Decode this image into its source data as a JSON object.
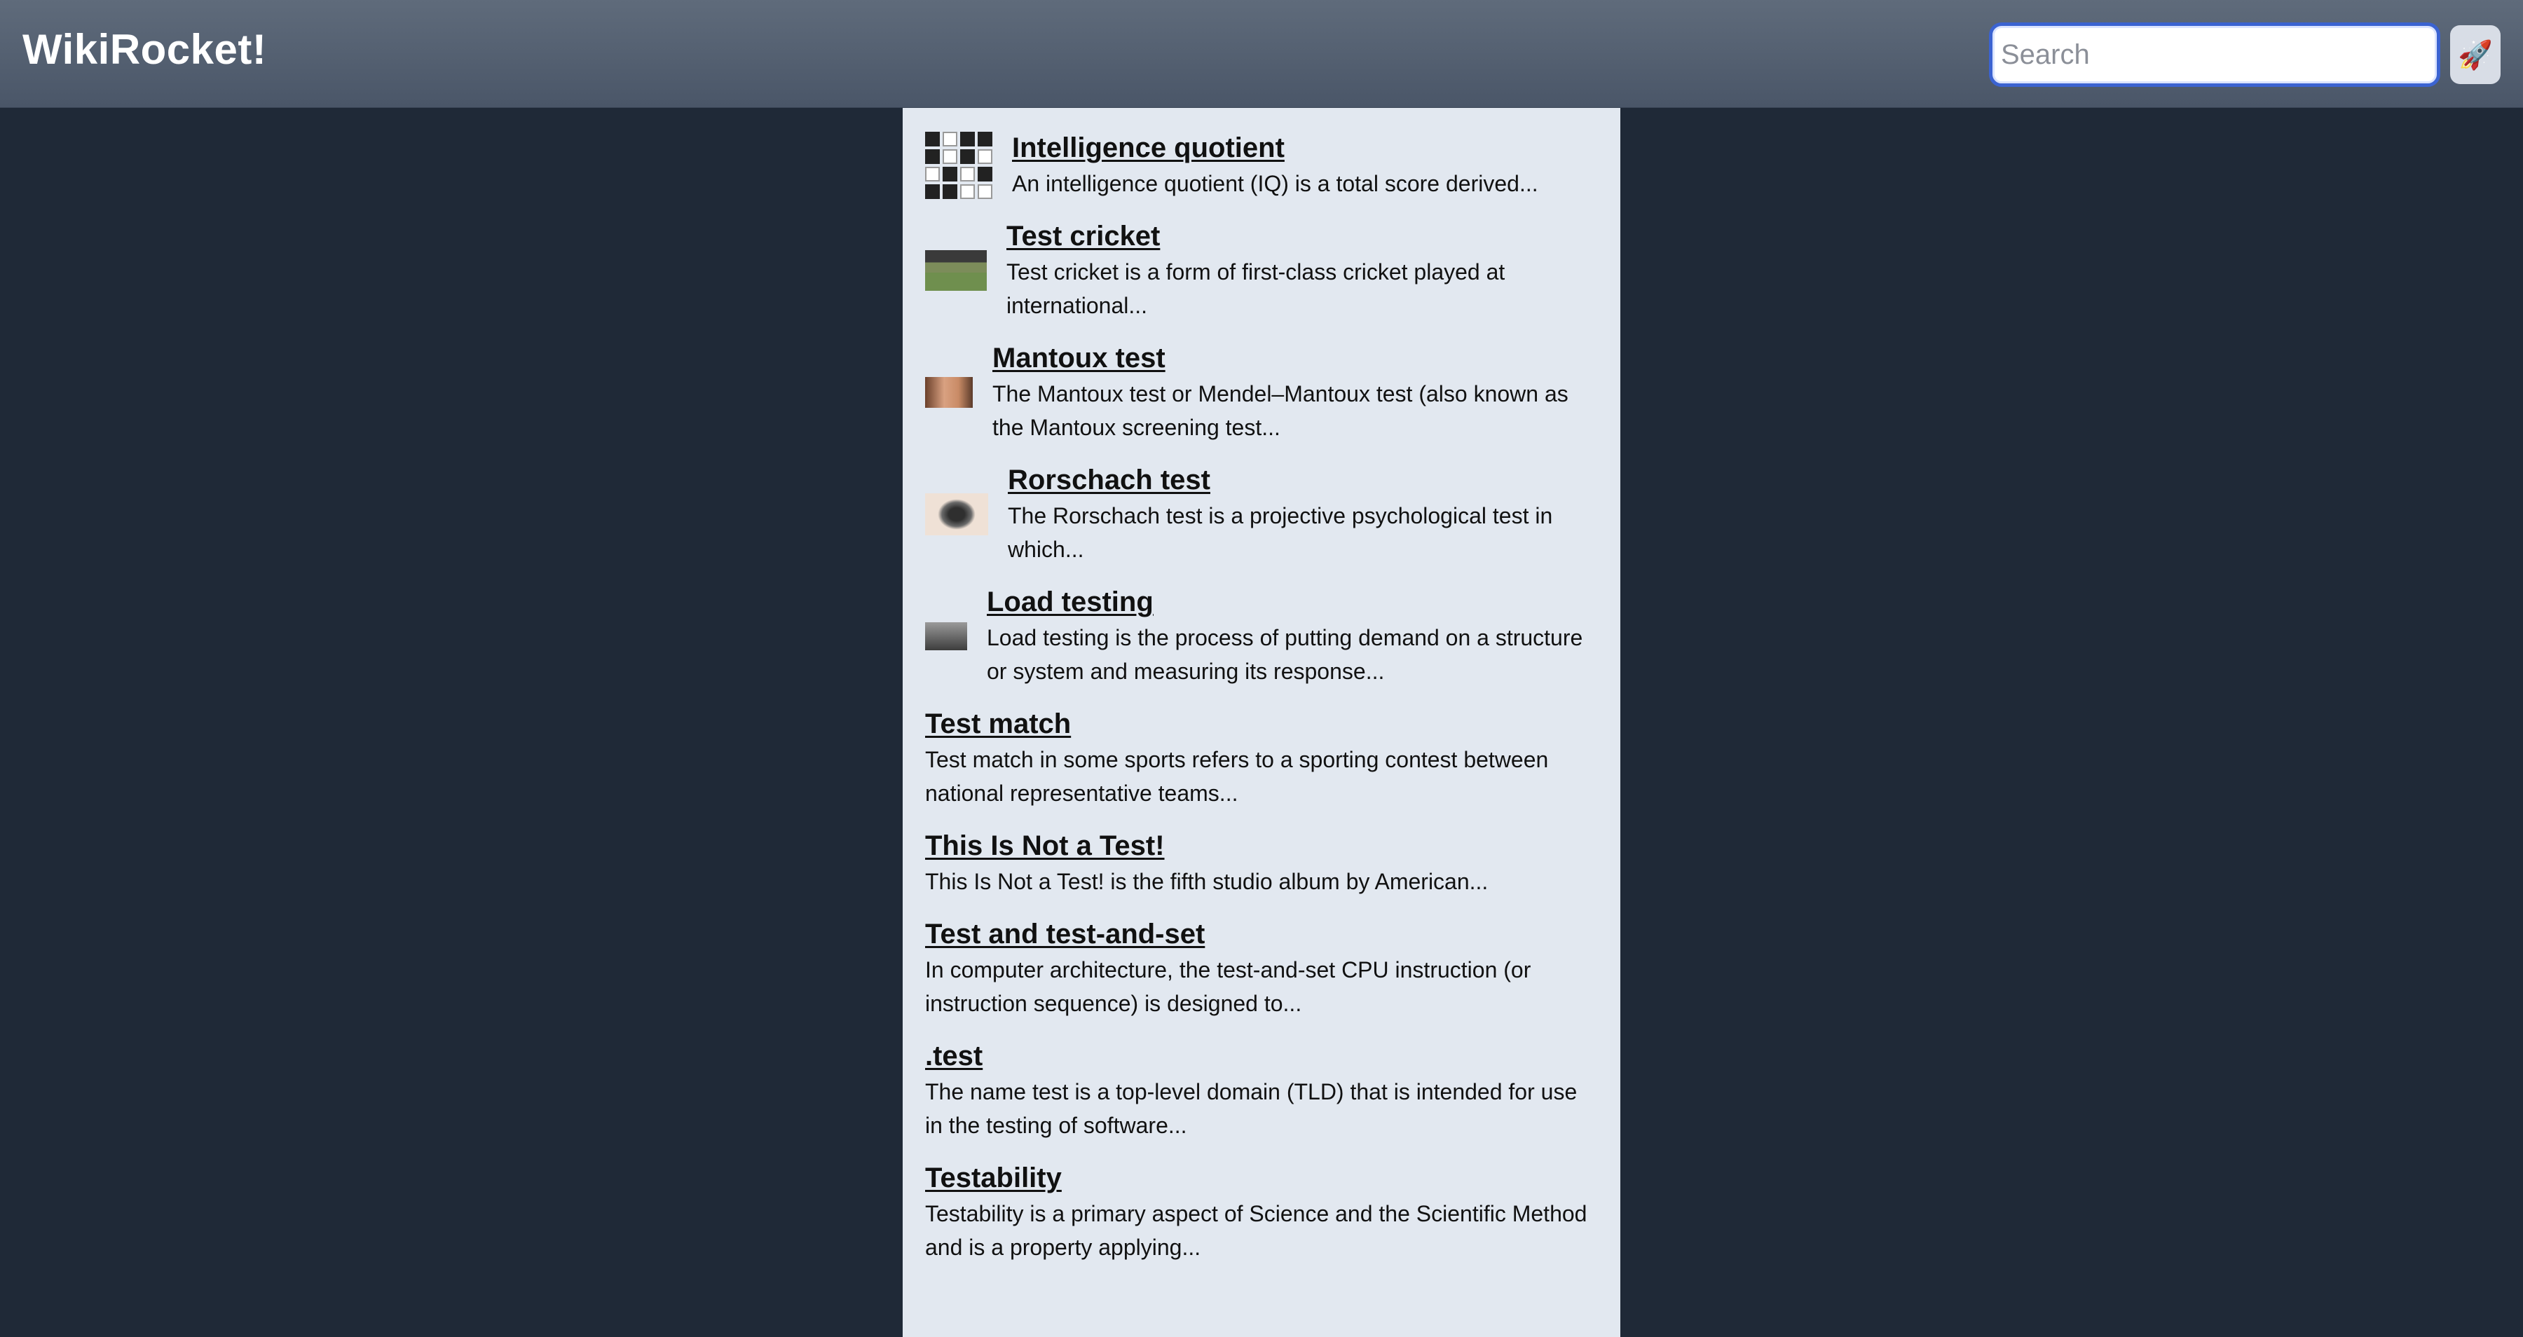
{
  "app": {
    "title": "WikiRocket!"
  },
  "search": {
    "placeholder": "Search",
    "value": "",
    "button_icon": "rocket-icon"
  },
  "results": [
    {
      "title": "Intelligence quotient",
      "snippet": "An intelligence quotient (IQ) is a total score derived...",
      "thumbnail": "iq-test-pattern"
    },
    {
      "title": "Test cricket",
      "snippet": "Test cricket is a form of first-class cricket played at international...",
      "thumbnail": "cricket-ground"
    },
    {
      "title": "Mantoux test",
      "snippet": "The Mantoux test or Mendel–Mantoux test (also known as the Mantoux screening test...",
      "thumbnail": "arm-injection"
    },
    {
      "title": "Rorschach test",
      "snippet": "The Rorschach test is a projective psychological test in which...",
      "thumbnail": "inkblot"
    },
    {
      "title": "Load testing",
      "snippet": "Load testing is the process of putting demand on a structure or system and measuring its response...",
      "thumbnail": "bridge-photo"
    },
    {
      "title": "Test match",
      "snippet": "Test match in some sports refers to a sporting contest between national representative teams..."
    },
    {
      "title": "This Is Not a Test!",
      "snippet": "This Is Not a Test! is the fifth studio album by American..."
    },
    {
      "title": "Test and test-and-set",
      "snippet": "In computer architecture, the test-and-set CPU instruction (or instruction sequence) is designed to..."
    },
    {
      "title": ".test",
      "snippet": "The name test is a top-level domain (TLD) that is intended for use in the testing of software..."
    },
    {
      "title": "Testability",
      "snippet": "Testability is a primary aspect of Science and the Scientific Method and is a property applying..."
    }
  ]
}
